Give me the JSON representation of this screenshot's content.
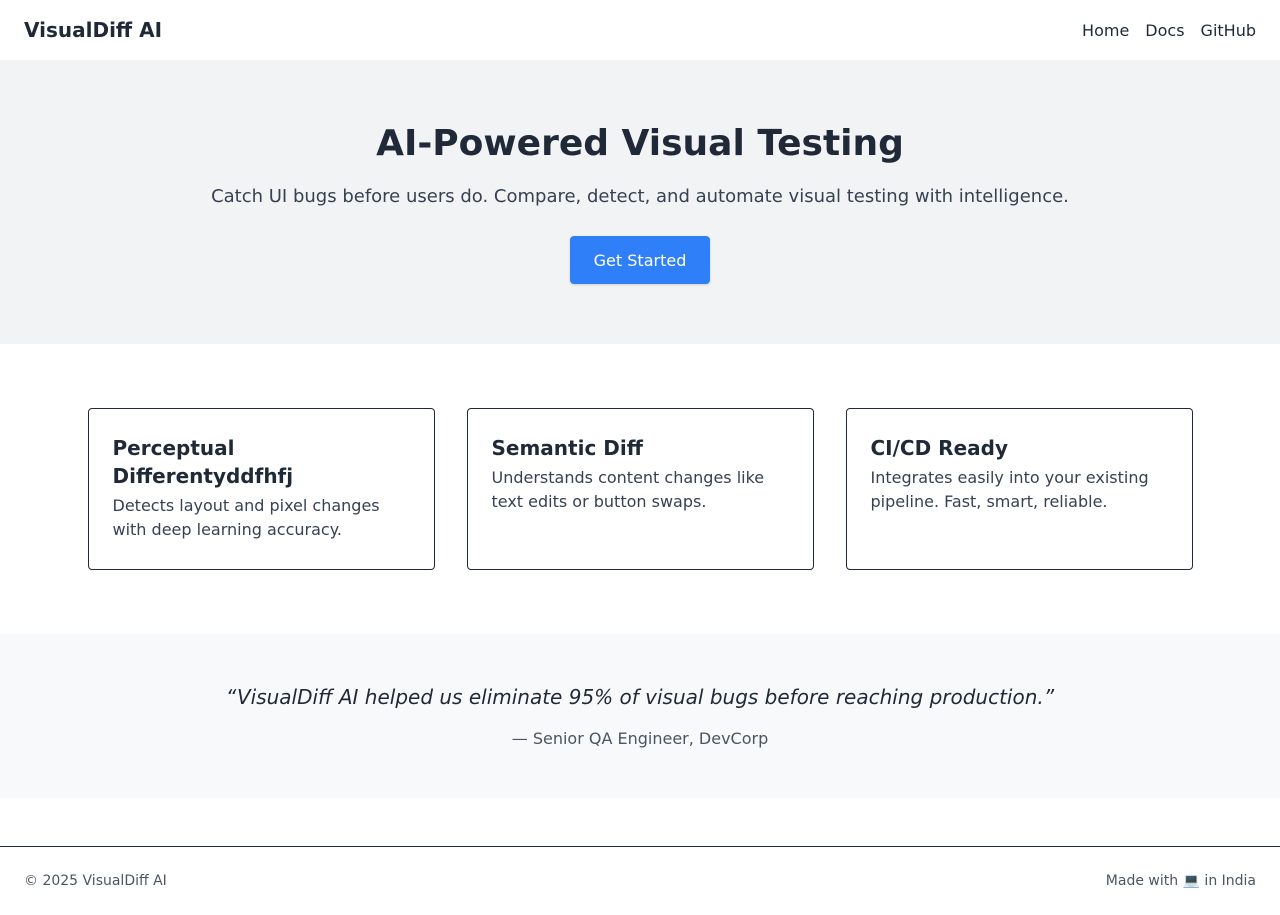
{
  "header": {
    "brand": "VisualDiff AI",
    "nav": [
      {
        "label": "Home"
      },
      {
        "label": "Docs"
      },
      {
        "label": "GitHub"
      }
    ]
  },
  "hero": {
    "title": "AI-Powered Visual Testing",
    "subtitle": "Catch UI bugs before users do. Compare, detect, and automate visual testing with intelligence.",
    "cta_label": "Get Started"
  },
  "features": [
    {
      "title": "Perceptual Differentyddfhfj",
      "description": "Detects layout and pixel changes with deep learning accuracy."
    },
    {
      "title": "Semantic Diff",
      "description": "Understands content changes like text edits or button swaps."
    },
    {
      "title": "CI/CD Ready",
      "description": "Integrates easily into your existing pipeline. Fast, smart, reliable."
    }
  ],
  "testimonial": {
    "quote": "“VisualDiff AI helped us eliminate 95% of visual bugs before reaching production.”",
    "author": "— Senior QA Engineer, DevCorp"
  },
  "footer": {
    "copyright": "© 2025 VisualDiff AI",
    "made_with": "Made with 💻 in India"
  },
  "colors": {
    "primary": "#2f7ff8",
    "text": "#1f2937",
    "hero_bg": "#f2f3f5",
    "testimonial_bg": "#f8f9fa"
  }
}
